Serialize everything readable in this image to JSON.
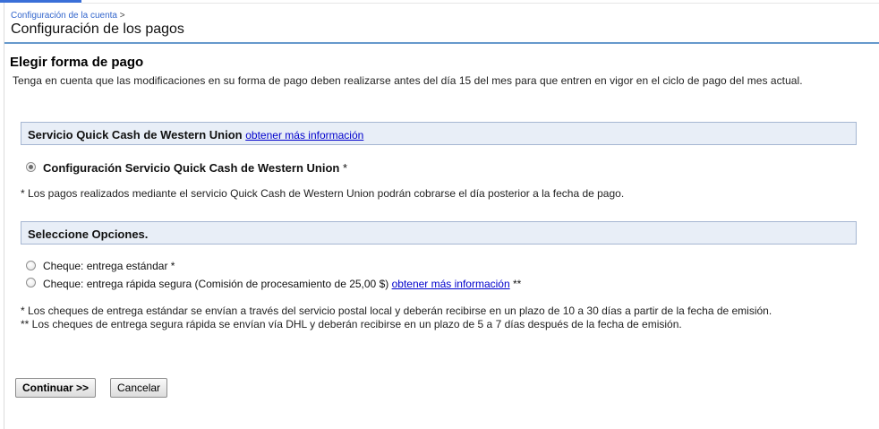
{
  "breadcrumb": {
    "link": "Configuración de la cuenta",
    "separator": ">"
  },
  "page_title": "Configuración de los pagos",
  "section": {
    "title": "Elegir forma de pago",
    "notice": "Tenga en cuenta que las modificaciones en su forma de pago deben realizarse antes del día 15 del mes para que entren en vigor en el ciclo de pago del mes actual."
  },
  "western_union": {
    "header": "Servicio Quick Cash de Western Union",
    "info_link": "obtener más información",
    "option_label": "Configuración Servicio Quick Cash de Western Union",
    "asterisk": "*",
    "selected": true,
    "note": "* Los pagos realizados mediante el servicio Quick Cash de Western Union podrán cobrarse el día posterior a la fecha de pago."
  },
  "options": {
    "header": "Seleccione Opciones.",
    "standard": {
      "label": "Cheque: entrega estándar *",
      "selected": false
    },
    "express": {
      "label": "Cheque: entrega rápida segura (Comisión de procesamiento de 25,00 $)",
      "info_link": "obtener más información",
      "suffix": "**",
      "selected": false
    },
    "note_standard": "* Los cheques de entrega estándar se envían a través del servicio postal local y deberán recibirse en un plazo de 10 a 30 días a partir de la fecha de emisión.",
    "note_express": "** Los cheques de entrega segura rápida se envían vía DHL y deberán recibirse en un plazo de 5 a 7 días después de la fecha de emisión."
  },
  "buttons": {
    "continue": "Continuar >>",
    "cancel": "Cancelar"
  },
  "colors": {
    "accent": "#3a6fd8",
    "link": "#0000cc",
    "header_bg": "#e8eef7",
    "header_border": "#a5b6d2",
    "rule": "#6699cc"
  }
}
